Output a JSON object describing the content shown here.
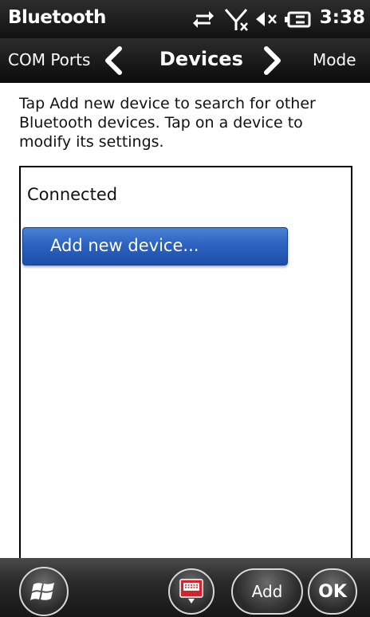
{
  "titlebar": {
    "app_title": "Bluetooth",
    "clock": "3:38",
    "icons": [
      "sync-arrows-icon",
      "no-signal-icon",
      "volume-muted-icon",
      "battery-charging-icon"
    ]
  },
  "navbar": {
    "prev_label": "COM Ports",
    "current_label": "Devices",
    "next_label": "Mode"
  },
  "instructions": "Tap Add new device to search for other Bluetooth devices. Tap on a device to modify its settings.",
  "device_list": {
    "header": "Connected",
    "add_item_label": "Add new device..."
  },
  "bottombar": {
    "add_label": "Add",
    "ok_label": "OK"
  },
  "colors": {
    "accent_blue": "#2c63c0",
    "bar_dark": "#1a1a1a",
    "keyboard_red": "#d9202a"
  }
}
